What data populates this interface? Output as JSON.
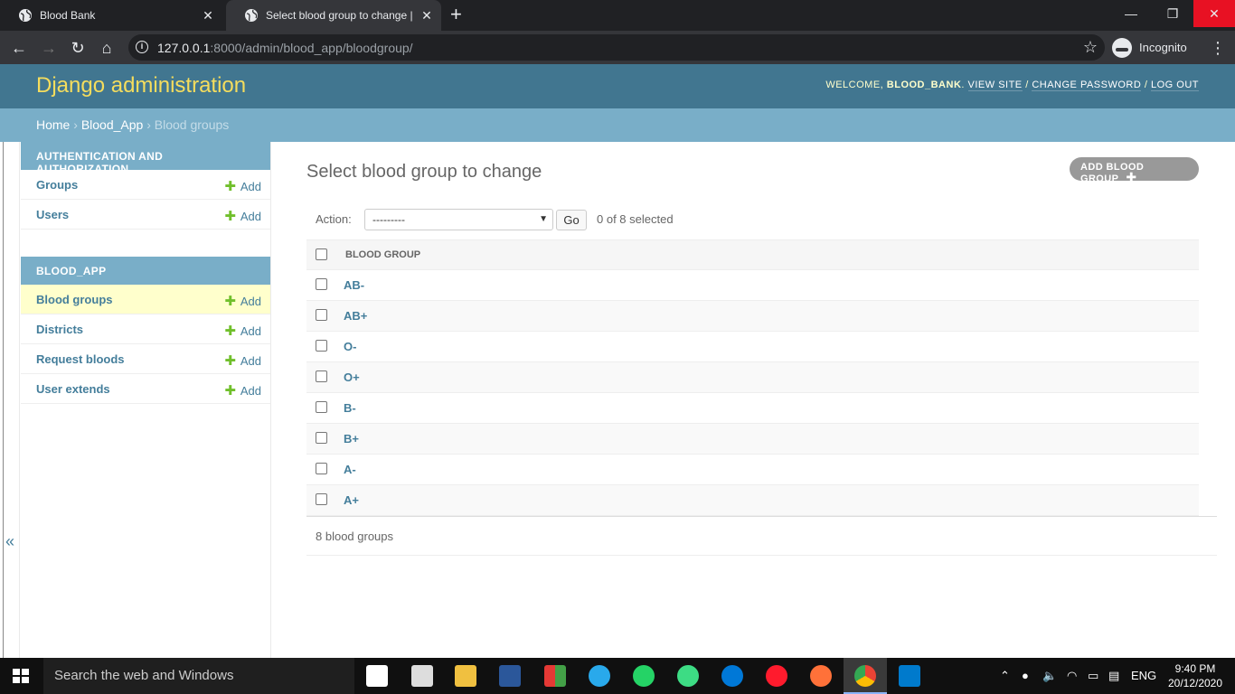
{
  "browser": {
    "tabs": [
      {
        "title": "Blood Bank",
        "active": false
      },
      {
        "title": "Select blood group to change | D",
        "active": true
      }
    ],
    "url_host": "127.0.0.1",
    "url_rest": ":8000/admin/blood_app/bloodgroup/",
    "profile_label": "Incognito"
  },
  "header": {
    "branding": "Django administration",
    "welcome": "WELCOME,",
    "username": "BLOOD_BANK",
    "view_site": "VIEW SITE",
    "change_password": "CHANGE PASSWORD",
    "log_out": "LOG OUT"
  },
  "breadcrumbs": {
    "home": "Home",
    "app": "Blood_App",
    "current": "Blood groups"
  },
  "sidebar": {
    "toggle": "«",
    "modules": [
      {
        "caption": "AUTHENTICATION AND AUTHORIZATION",
        "models": [
          {
            "name": "Groups",
            "add": "Add",
            "current": false
          },
          {
            "name": "Users",
            "add": "Add",
            "current": false
          }
        ]
      },
      {
        "caption": "BLOOD_APP",
        "models": [
          {
            "name": "Blood groups",
            "add": "Add",
            "current": true
          },
          {
            "name": "Districts",
            "add": "Add",
            "current": false
          },
          {
            "name": "Request bloods",
            "add": "Add",
            "current": false
          },
          {
            "name": "User extends",
            "add": "Add",
            "current": false
          }
        ]
      }
    ]
  },
  "main": {
    "title": "Select blood group to change",
    "add_button": "ADD BLOOD GROUP",
    "action_label": "Action:",
    "action_selected": "---------",
    "go_label": "Go",
    "selection_counter": "0 of 8 selected",
    "column_header": "BLOOD GROUP",
    "rows": [
      "AB-",
      "AB+",
      "O-",
      "O+",
      "B-",
      "B+",
      "A-",
      "A+"
    ],
    "paginator": "8 blood groups"
  },
  "taskbar": {
    "search_placeholder": "Search the web and Windows",
    "language": "ENG",
    "time": "9:40 PM",
    "date": "20/12/2020"
  },
  "colors": {
    "header_bg": "#417690",
    "branding": "#f5dd5d",
    "breadcrumbs_bg": "#79aec8",
    "link": "#447e9b",
    "add_plus": "#70bf2b",
    "current_row": "#ffffcc"
  }
}
